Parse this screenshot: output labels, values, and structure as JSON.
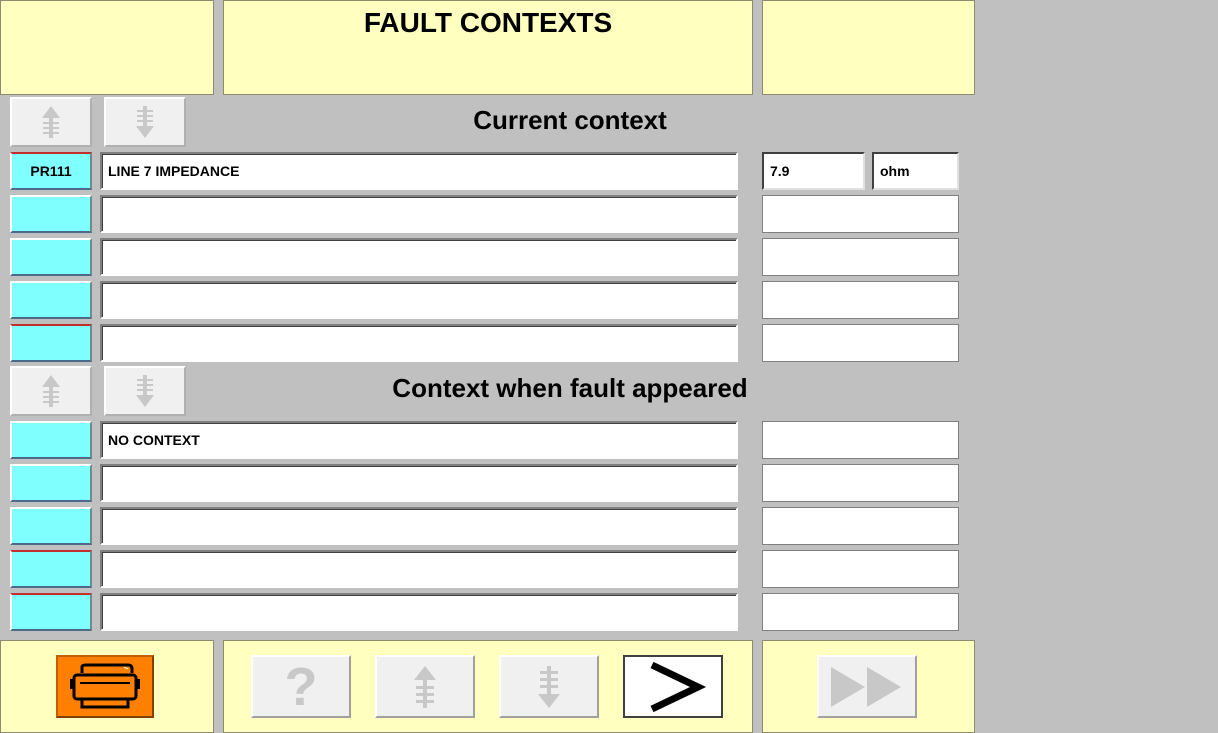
{
  "header": {
    "title": "FAULT CONTEXTS"
  },
  "current_context": {
    "title": "Current context",
    "rows": [
      {
        "code": "PR111",
        "label": "LINE 7 IMPEDANCE",
        "value": "7.9",
        "unit": "ohm"
      },
      {
        "code": "",
        "label": "",
        "value": "",
        "unit": ""
      },
      {
        "code": "",
        "label": "",
        "value": "",
        "unit": ""
      },
      {
        "code": "",
        "label": "",
        "value": "",
        "unit": ""
      },
      {
        "code": "",
        "label": "",
        "value": "",
        "unit": ""
      }
    ]
  },
  "fault_context": {
    "title": "Context when fault appeared",
    "rows": [
      {
        "code": "",
        "label": "NO CONTEXT",
        "value": ""
      },
      {
        "code": "",
        "label": "",
        "value": ""
      },
      {
        "code": "",
        "label": "",
        "value": ""
      },
      {
        "code": "",
        "label": "",
        "value": ""
      },
      {
        "code": "",
        "label": "",
        "value": ""
      }
    ]
  },
  "toolbar": {
    "help_label": "?",
    "next_label": ">"
  },
  "colors": {
    "panel": "#ffffc0",
    "code_button": "#80ffff",
    "print_button": "#ff8000",
    "background": "#c0c0c0"
  },
  "icons": [
    "scroll-up-icon",
    "scroll-down-icon",
    "printer-icon",
    "help-icon",
    "next-icon",
    "fast-forward-icon"
  ]
}
